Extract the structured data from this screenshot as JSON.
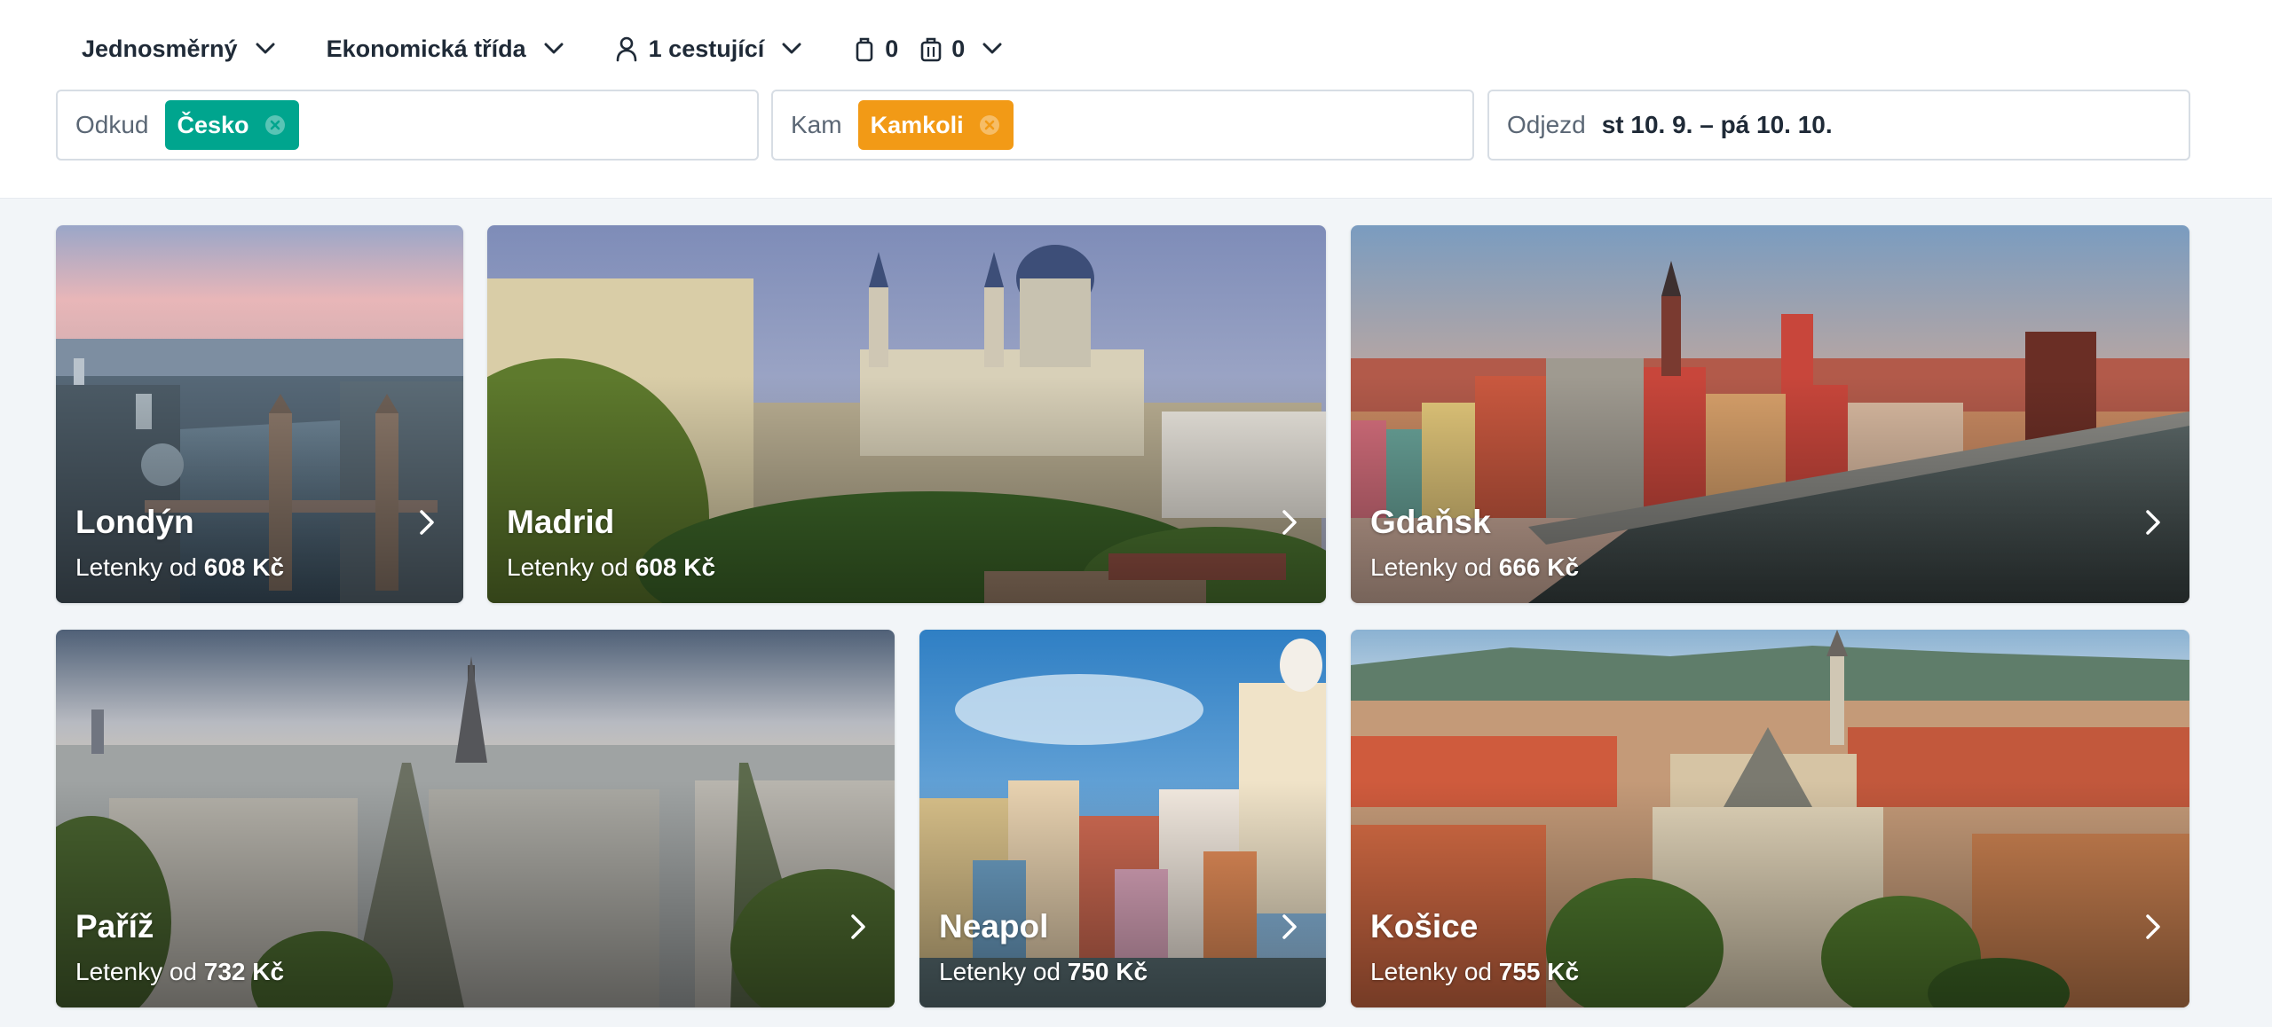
{
  "filters": {
    "trip_type": "Jednosměrný",
    "cabin_class": "Ekonomická třída",
    "passengers": "1 cestující",
    "cabin_bags": "0",
    "checked_bags": "0"
  },
  "search": {
    "from_label": "Odkud",
    "from_value": "Česko",
    "to_label": "Kam",
    "to_value": "Kamkoli",
    "depart_label": "Odjezd",
    "depart_value": "st 10. 9. – pá 10. 10."
  },
  "colors": {
    "origin_chip": "#00a58e",
    "destination_chip": "#f29a16"
  },
  "price_prefix": "Letenky od",
  "destinations": [
    {
      "city": "Londýn",
      "price": "608 Kč"
    },
    {
      "city": "Madrid",
      "price": "608 Kč"
    },
    {
      "city": "Gdaňsk",
      "price": "666 Kč"
    },
    {
      "city": "Paříž",
      "price": "732 Kč"
    },
    {
      "city": "Neapol",
      "price": "750 Kč"
    },
    {
      "city": "Košice",
      "price": "755 Kč"
    }
  ]
}
